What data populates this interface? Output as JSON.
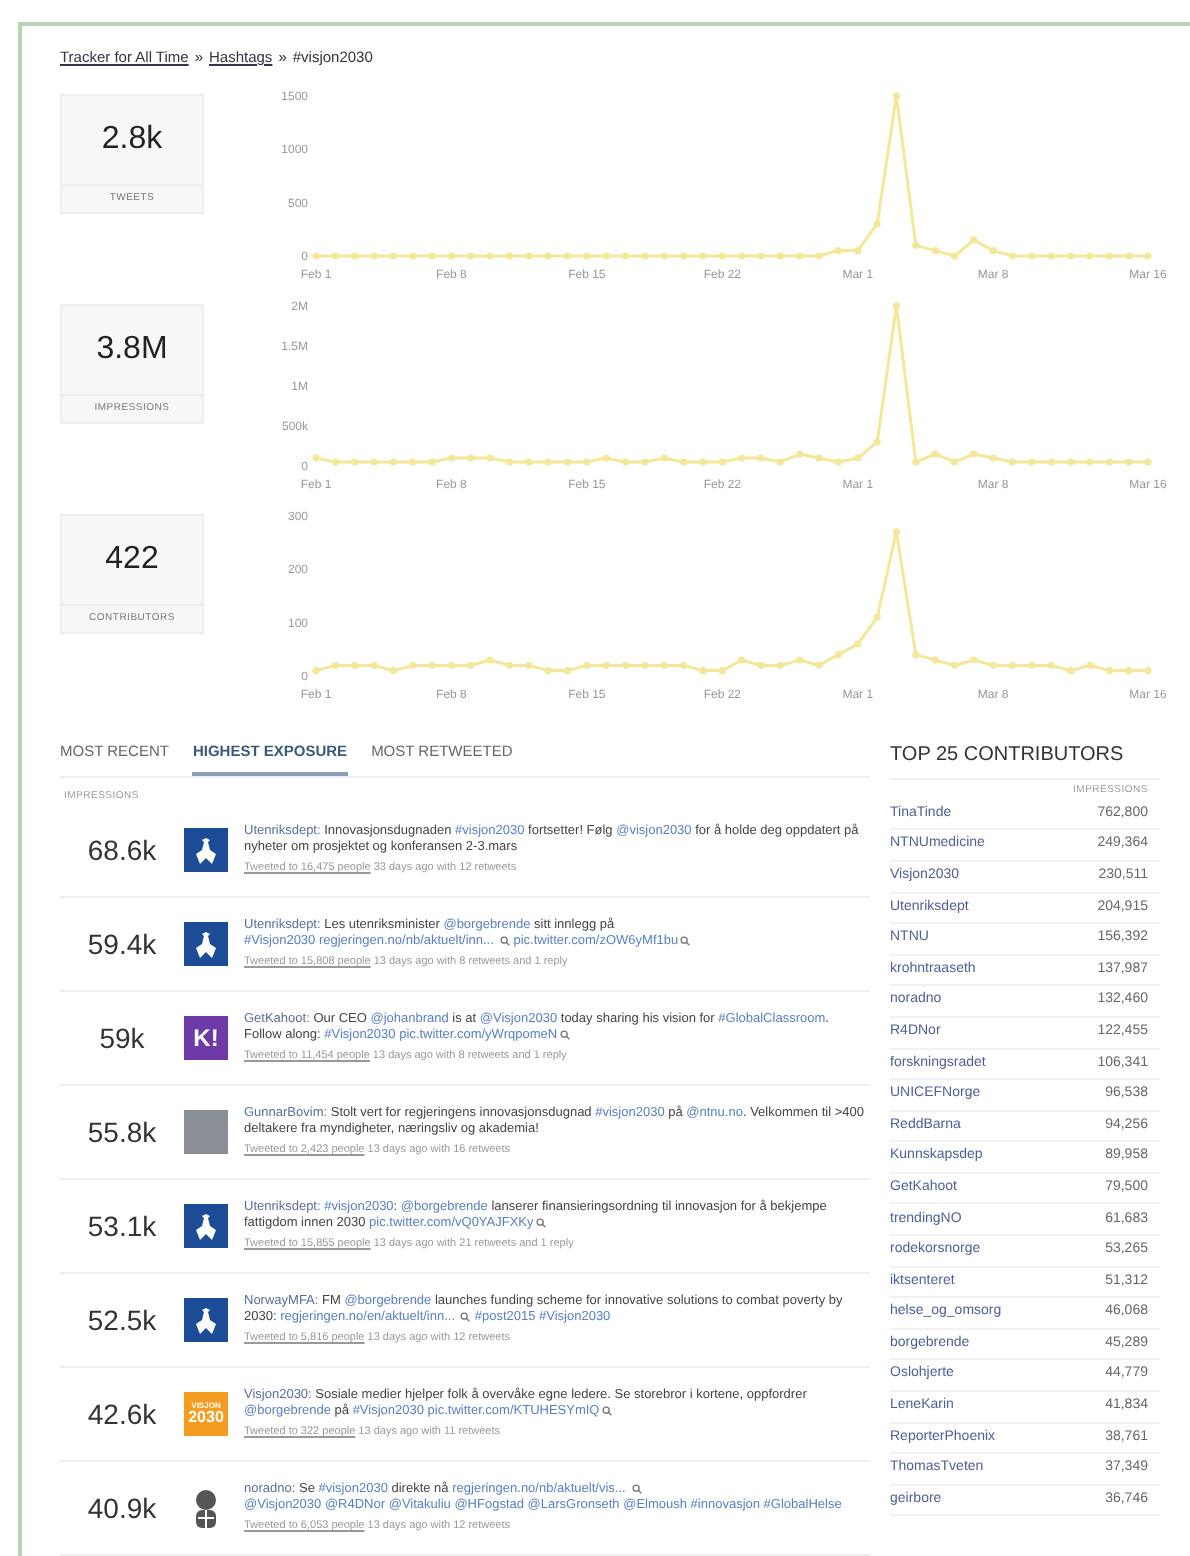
{
  "breadcrumb": [
    {
      "text": "Tracker for All Time",
      "link": true
    },
    {
      "text": "»",
      "link": false
    },
    {
      "text": "Hashtags",
      "link": true
    },
    {
      "text": "»",
      "link": false
    },
    {
      "text": "#visjon2030",
      "link": false
    }
  ],
  "stats": [
    {
      "value": "2.8k",
      "label": "TWEETS",
      "chart_data": {
        "type": "line",
        "categories": [
          "Feb 1",
          null,
          null,
          null,
          null,
          null,
          null,
          "Feb 8",
          null,
          null,
          null,
          null,
          null,
          null,
          "Feb 15",
          null,
          null,
          null,
          null,
          null,
          null,
          "Feb 22",
          null,
          null,
          null,
          null,
          null,
          null,
          "Mar 1",
          null,
          null,
          null,
          null,
          null,
          null,
          "Mar 8",
          null,
          null,
          null,
          null,
          null,
          null,
          null,
          "Mar 16"
        ],
        "ylim": [
          0,
          1500
        ],
        "yticks": [
          0,
          500,
          1000,
          1500
        ],
        "series": [
          {
            "color": "#f3e79a",
            "marker": true,
            "values": [
              0,
              0,
              0,
              0,
              0,
              0,
              0,
              0,
              0,
              0,
              0,
              0,
              0,
              0,
              0,
              0,
              0,
              0,
              0,
              0,
              0,
              0,
              0,
              0,
              0,
              0,
              0,
              50,
              50,
              300,
              1500,
              100,
              50,
              0,
              150,
              50,
              0,
              0,
              0,
              0,
              0,
              0,
              0,
              0
            ]
          }
        ]
      }
    },
    {
      "value": "3.8M",
      "label": "IMPRESSIONS",
      "chart_data": {
        "type": "line",
        "categories": [
          "Feb 1",
          null,
          null,
          null,
          null,
          null,
          null,
          "Feb 8",
          null,
          null,
          null,
          null,
          null,
          null,
          "Feb 15",
          null,
          null,
          null,
          null,
          null,
          null,
          "Feb 22",
          null,
          null,
          null,
          null,
          null,
          null,
          "Mar 1",
          null,
          null,
          null,
          null,
          null,
          null,
          "Mar 8",
          null,
          null,
          null,
          null,
          null,
          null,
          null,
          "Mar 16"
        ],
        "ylim": [
          0,
          2000000
        ],
        "yticks": [
          {
            "value": 0,
            "label": "0"
          },
          {
            "value": 500000,
            "label": "500k"
          },
          {
            "value": 1000000,
            "label": "1M"
          },
          {
            "value": 1500000,
            "label": "1.5M"
          },
          {
            "value": 2000000,
            "label": "2M"
          }
        ],
        "series": [
          {
            "color": "#f3e79a",
            "marker": true,
            "values": [
              100000,
              50000,
              50000,
              50000,
              50000,
              50000,
              50000,
              100000,
              100000,
              100000,
              50000,
              50000,
              50000,
              50000,
              50000,
              100000,
              50000,
              50000,
              100000,
              50000,
              50000,
              50000,
              100000,
              100000,
              50000,
              150000,
              100000,
              50000,
              100000,
              300000,
              2000000,
              50000,
              150000,
              50000,
              150000,
              100000,
              50000,
              50000,
              50000,
              50000,
              50000,
              50000,
              50000,
              50000
            ]
          }
        ]
      }
    },
    {
      "value": "422",
      "label": "CONTRIBUTORS",
      "chart_data": {
        "type": "line",
        "categories": [
          "Feb 1",
          null,
          null,
          null,
          null,
          null,
          null,
          "Feb 8",
          null,
          null,
          null,
          null,
          null,
          null,
          "Feb 15",
          null,
          null,
          null,
          null,
          null,
          null,
          "Feb 22",
          null,
          null,
          null,
          null,
          null,
          null,
          "Mar 1",
          null,
          null,
          null,
          null,
          null,
          null,
          "Mar 8",
          null,
          null,
          null,
          null,
          null,
          null,
          null,
          "Mar 16"
        ],
        "ylim": [
          0,
          300
        ],
        "yticks": [
          0,
          100,
          200,
          300
        ],
        "series": [
          {
            "color": "#f3e79a",
            "marker": true,
            "values": [
              10,
              20,
              20,
              20,
              10,
              20,
              20,
              20,
              20,
              30,
              20,
              20,
              10,
              10,
              20,
              20,
              20,
              20,
              20,
              20,
              10,
              10,
              30,
              20,
              20,
              30,
              20,
              40,
              60,
              110,
              270,
              40,
              30,
              20,
              30,
              20,
              20,
              20,
              20,
              10,
              20,
              10,
              10,
              10
            ]
          }
        ]
      }
    }
  ],
  "tabs": [
    {
      "label": "MOST RECENT",
      "selected": false
    },
    {
      "label": "HIGHEST EXPOSURE",
      "selected": true
    },
    {
      "label": "MOST RETWEETED",
      "selected": false
    }
  ],
  "tweets_column": "IMPRESSIONS",
  "tweets": [
    {
      "impressions": "68.6k",
      "avatar": {
        "kind": "crest"
      },
      "author": "Utenriksdept:",
      "segments": [
        {
          "text": " Innovasjonsdugnaden ",
          "link": false
        },
        {
          "text": "#visjon2030",
          "link": true
        },
        {
          "text": " fortsetter! Følg ",
          "link": false
        },
        {
          "text": "@visjon2030",
          "link": true
        },
        {
          "text": " for å holde deg oppdatert på nyheter om prosjektet og konferansen 2-3.mars",
          "link": false
        }
      ],
      "reach": "Tweeted to 16,475 people",
      "meta": " 33 days ago with 12 retweets"
    },
    {
      "impressions": "59.4k",
      "avatar": {
        "kind": "crest"
      },
      "author": "Utenriksdept:",
      "segments": [
        {
          "text": " Les utenriksminister ",
          "link": false
        },
        {
          "text": "@borgebrende",
          "link": true
        },
        {
          "text": " sitt innlegg på ",
          "link": false
        },
        {
          "text": "#Visjon2030 ",
          "link": true
        },
        {
          "text": "regjeringen.no/nb/aktuelt/inn... ",
          "link": true,
          "preview": true
        },
        {
          "text": "pic.twitter.com/zOW6yMf1bu",
          "link": true,
          "preview": true
        }
      ],
      "reach": "Tweeted to 15,808 people",
      "meta": " 13 days ago with 8 retweets and 1 reply"
    },
    {
      "impressions": "59k",
      "avatar": {
        "kind": "kahoot",
        "text": "K!"
      },
      "author": "GetKahoot:",
      "segments": [
        {
          "text": " Our CEO ",
          "link": false
        },
        {
          "text": "@johanbrand",
          "link": true
        },
        {
          "text": " is at ",
          "link": false
        },
        {
          "text": "@Visjon2030",
          "link": true
        },
        {
          "text": " today sharing his vision for ",
          "link": false
        },
        {
          "text": "#GlobalClassroom",
          "link": true
        },
        {
          "text": ". Follow along: ",
          "link": false
        },
        {
          "text": "#Visjon2030 ",
          "link": true
        },
        {
          "text": "pic.twitter.com/yWrqpomeN",
          "link": true,
          "preview": true
        }
      ],
      "reach": "Tweeted to 11,454 people",
      "meta": " 13 days ago with 8 retweets and 1 reply"
    },
    {
      "impressions": "55.8k",
      "avatar": {
        "kind": "photo"
      },
      "author": "GunnarBovim:",
      "segments": [
        {
          "text": " Stolt vert for regjeringens innovasjonsdugnad ",
          "link": false
        },
        {
          "text": "#visjon2030",
          "link": true
        },
        {
          "text": " på ",
          "link": false
        },
        {
          "text": "@ntnu.no",
          "link": true
        },
        {
          "text": ". Velkommen til >400 deltakere fra myndigheter, næringsliv og akademia!",
          "link": false
        }
      ],
      "reach": "Tweeted to 2,423 people",
      "meta": " 13 days ago with 16 retweets"
    },
    {
      "impressions": "53.1k",
      "avatar": {
        "kind": "crest"
      },
      "author": "Utenriksdept:",
      "segments": [
        {
          "text": " #visjon2030",
          "link": true
        },
        {
          "text": ": ",
          "link": false
        },
        {
          "text": "@borgebrende",
          "link": true
        },
        {
          "text": " lanserer finansieringsordning til innovasjon for å bekjempe fattigdom innen 2030 ",
          "link": false
        },
        {
          "text": "pic.twitter.com/vQ0YAJFXKy",
          "link": true,
          "preview": true
        }
      ],
      "reach": "Tweeted to 15,855 people",
      "meta": " 13 days ago with 21 retweets and 1 reply"
    },
    {
      "impressions": "52.5k",
      "avatar": {
        "kind": "crest"
      },
      "author": "NorwayMFA:",
      "segments": [
        {
          "text": " FM ",
          "link": false
        },
        {
          "text": "@borgebrende",
          "link": true
        },
        {
          "text": " launches funding scheme for innovative solutions to combat poverty by 2030: ",
          "link": false
        },
        {
          "text": "regjeringen.no/en/aktuelt/inn... ",
          "link": true,
          "preview": true
        },
        {
          "text": "#post2015 ",
          "link": true
        },
        {
          "text": "#Visjon2030",
          "link": true
        }
      ],
      "reach": "Tweeted to 5,816 people",
      "meta": " 13 days ago with 12 retweets"
    },
    {
      "impressions": "42.6k",
      "avatar": {
        "kind": "visjon",
        "text": "VISJON",
        "text2": "2030"
      },
      "author": "Visjon2030:",
      "segments": [
        {
          "text": " Sosiale medier hjelper folk å overvåke egne ledere. Se storebror i kortene, oppfordrer ",
          "link": false
        },
        {
          "text": "@borgebrende",
          "link": true
        },
        {
          "text": " på ",
          "link": false
        },
        {
          "text": "#Visjon2030 ",
          "link": true
        },
        {
          "text": "pic.twitter.com/KTUHESYmIQ",
          "link": true,
          "preview": true
        }
      ],
      "reach": "Tweeted to 322 people",
      "meta": " 13 days ago with 11 retweets"
    },
    {
      "impressions": "40.9k",
      "avatar": {
        "kind": "emblem"
      },
      "author": "noradno:",
      "segments": [
        {
          "text": " Se ",
          "link": false
        },
        {
          "text": "#visjon2030",
          "link": true
        },
        {
          "text": " direkte nå ",
          "link": false
        },
        {
          "text": "regjeringen.no/nb/aktuelt/vis... ",
          "link": true,
          "preview": true
        },
        {
          "text": "@Visjon2030 ",
          "link": true
        },
        {
          "text": "@R4DNor ",
          "link": true
        },
        {
          "text": "@Vitakuliu ",
          "link": true
        },
        {
          "text": "@HFogstad ",
          "link": true
        },
        {
          "text": "@LarsGronseth ",
          "link": true
        },
        {
          "text": "@Elmoush ",
          "link": true
        },
        {
          "text": "#innovasjon ",
          "link": true
        },
        {
          "text": "#GlobalHelse",
          "link": true
        }
      ],
      "reach": "Tweeted to 6,053 people",
      "meta": " 13 days ago with 12 retweets"
    }
  ],
  "contributors": {
    "title": "TOP 25 CONTRIBUTORS",
    "column": "IMPRESSIONS",
    "rows": [
      {
        "name": "TinaTinde",
        "value": "762,800"
      },
      {
        "name": "NTNUmedicine",
        "value": "249,364"
      },
      {
        "name": "Visjon2030",
        "value": "230,511"
      },
      {
        "name": "Utenriksdept",
        "value": "204,915"
      },
      {
        "name": "NTNU",
        "value": "156,392"
      },
      {
        "name": "krohntraaseth",
        "value": "137,987"
      },
      {
        "name": "noradno",
        "value": "132,460"
      },
      {
        "name": "R4DNor",
        "value": "122,455"
      },
      {
        "name": "forskningsradet",
        "value": "106,341"
      },
      {
        "name": "UNICEFNorge",
        "value": "96,538"
      },
      {
        "name": "ReddBarna",
        "value": "94,256"
      },
      {
        "name": "Kunnskapsdep",
        "value": "89,958"
      },
      {
        "name": "GetKahoot",
        "value": "79,500"
      },
      {
        "name": "trendingNO",
        "value": "61,683"
      },
      {
        "name": "rodekorsnorge",
        "value": "53,265"
      },
      {
        "name": "iktsenteret",
        "value": "51,312"
      },
      {
        "name": "helse_og_omsorg",
        "value": "46,068"
      },
      {
        "name": "borgebrende",
        "value": "45,289"
      },
      {
        "name": "Oslohjerte",
        "value": "44,779"
      },
      {
        "name": "LeneKarin",
        "value": "41,834"
      },
      {
        "name": "ReporterPhoenix",
        "value": "38,761"
      },
      {
        "name": "ThomasTveten",
        "value": "37,349"
      },
      {
        "name": "geirbore",
        "value": "36,746"
      }
    ]
  }
}
